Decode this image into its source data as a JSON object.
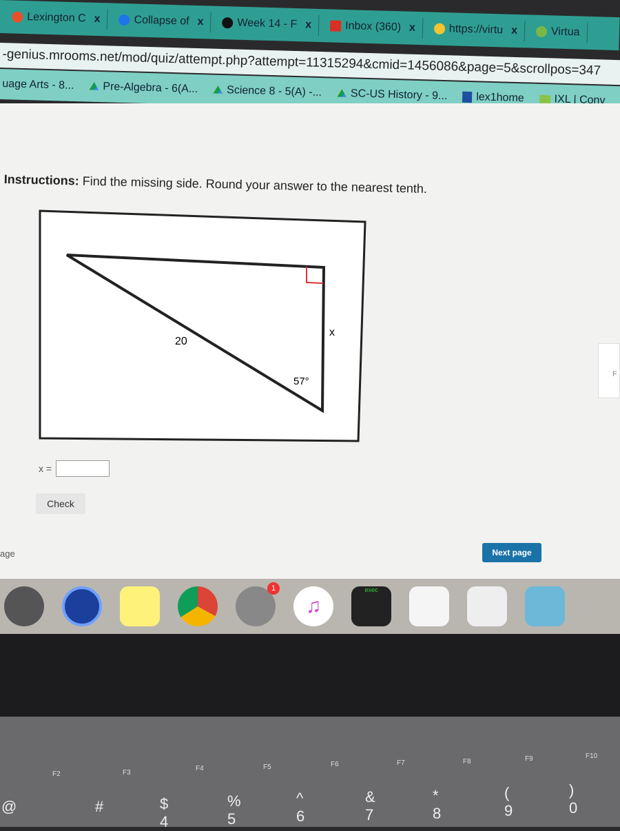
{
  "browser": {
    "tabs": [
      {
        "label": "Lexington C",
        "color": "#e8502a"
      },
      {
        "label": "Collapse of",
        "color": "#1e74e8"
      },
      {
        "label": "Week 14 - F",
        "color": "#111111"
      },
      {
        "label": "Inbox (360)",
        "color": "#d93025"
      },
      {
        "label": "https://virtu",
        "color": "#f4c430"
      },
      {
        "label": "Virtua",
        "color": "#7ab648"
      }
    ],
    "close_label": "x",
    "url": "-genius.mrooms.net/mod/quiz/attempt.php?attempt=11315294&cmid=1456086&page=5&scrollpos=347",
    "bookmarks": [
      "uage Arts - 8...",
      "Pre-Algebra - 6(A...",
      "Science 8 - 5(A) -...",
      "SC-US History - 9...",
      "lex1home",
      "IXL | Conv"
    ]
  },
  "quiz": {
    "instructions_bold": "Instructions:",
    "instructions": " Find the missing side. Round your answer to the nearest tenth.",
    "figure": {
      "hypotenuse": "20",
      "angle": "57°",
      "unknown": "x"
    },
    "answer_label": "x =",
    "answer_value": "",
    "check_label": "Check",
    "next_label": "Next page",
    "side_label": "age",
    "side_panel_label": "F"
  },
  "dock": {
    "mail_badge": "1",
    "terminal_label": "exec"
  },
  "keyboard": {
    "fkeys": [
      "F2",
      "F3",
      "F4",
      "F5",
      "F6",
      "F7",
      "F8",
      "F9",
      "F10"
    ],
    "keys": [
      "@",
      "#",
      "$",
      "%",
      "^",
      "&",
      "*",
      "(",
      ")"
    ],
    "numbers": [
      "",
      "",
      "4",
      "5",
      "6",
      "7",
      "8",
      "9",
      "0"
    ]
  }
}
